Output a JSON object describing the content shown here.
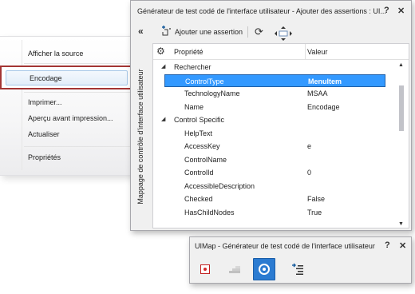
{
  "context_menu": {
    "items": [
      {
        "label": "Afficher la source"
      },
      {
        "label": "Encodage",
        "highlighted": true
      },
      {
        "label": "Imprimer..."
      },
      {
        "label": "Aperçu avant impression..."
      },
      {
        "label": "Actualiser"
      },
      {
        "label": "Propriétés"
      }
    ]
  },
  "main_window": {
    "title": "Générateur de test codé de l'interface utilisateur - Ajouter des assertions : UI...",
    "help_icon": "help-icon",
    "close_icon": "close-icon",
    "toolbar": {
      "collapse_icon": "double-chevron-left-icon",
      "add_assertion_label": "Ajouter une assertion",
      "refresh_icon": "refresh-icon",
      "navigate_icon": "navigate-arrows-icon"
    },
    "side_label": "Mappage de contrôle d'interface utilisateur",
    "grid": {
      "col_property": "Propriété",
      "col_value": "Valeur",
      "rows": [
        {
          "name": "Rechercher",
          "value": "",
          "kind": "group"
        },
        {
          "name": "ControlType",
          "value": "MenuItem",
          "kind": "prop",
          "selected": true
        },
        {
          "name": "TechnologyName",
          "value": "MSAA",
          "kind": "prop"
        },
        {
          "name": "Name",
          "value": "Encodage",
          "kind": "prop"
        },
        {
          "name": "Control Specific",
          "value": "",
          "kind": "group"
        },
        {
          "name": "HelpText",
          "value": "",
          "kind": "prop"
        },
        {
          "name": "AccessKey",
          "value": "e",
          "kind": "prop"
        },
        {
          "name": "ControlName",
          "value": "",
          "kind": "prop"
        },
        {
          "name": "ControlId",
          "value": "0",
          "kind": "prop"
        },
        {
          "name": "AccessibleDescription",
          "value": "",
          "kind": "prop"
        },
        {
          "name": "Checked",
          "value": "False",
          "kind": "prop"
        },
        {
          "name": "HasChildNodes",
          "value": "True",
          "kind": "prop"
        }
      ]
    }
  },
  "uimap_window": {
    "title": "UIMap - Générateur de test codé de l'interface utilisateur",
    "tools": [
      {
        "name": "record-icon"
      },
      {
        "name": "recorded-steps-icon"
      },
      {
        "name": "crosshair-target-icon",
        "active": true
      },
      {
        "name": "generate-code-icon"
      }
    ]
  },
  "colors": {
    "selection": "#3399ff",
    "highlight_border": "#a43534",
    "active_tool": "#2b7bd1"
  }
}
